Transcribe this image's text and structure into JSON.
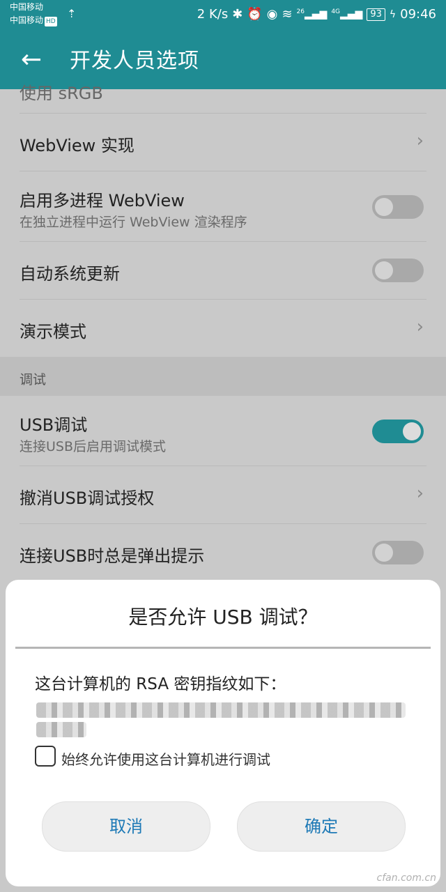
{
  "status_bar": {
    "carrier1": "中国移动",
    "carrier2": "中国移动",
    "hd_badge": "HD",
    "speed": "2 K/s",
    "signal1_label": "26",
    "signal2_label": "4G",
    "battery": "93",
    "time": "09:46",
    "icons": [
      "usb-icon",
      "bluetooth-icon",
      "alarm-icon",
      "eye-comfort-icon",
      "wifi-icon",
      "signal-icon",
      "charging-icon"
    ]
  },
  "app_bar": {
    "title": "开发人员选项"
  },
  "settings": {
    "partial_top": "使用 sRGB",
    "webview_impl": "WebView 实现",
    "multiprocess_title": "启用多进程 WebView",
    "multiprocess_sub": "在独立进程中运行 WebView 渲染程序",
    "auto_update": "自动系统更新",
    "demo_mode": "演示模式",
    "section_debug": "调试",
    "usb_debug_title": "USB调试",
    "usb_debug_sub": "连接USB后启用调试模式",
    "revoke_usb": "撤消USB调试授权",
    "usb_popup": "连接USB时总是弹出提示"
  },
  "toggles": {
    "multiprocess": false,
    "auto_update": false,
    "usb_debug": true,
    "usb_popup": false
  },
  "dialog": {
    "title": "是否允许 USB 调试？",
    "message": "这台计算机的 RSA 密钥指纹如下：",
    "checkbox_label": "始终允许使用这台计算机进行调试",
    "checkbox_checked": false,
    "cancel": "取消",
    "ok": "确定"
  },
  "watermark": "cfan.com.cn",
  "colors": {
    "accent": "#1f8c93",
    "button_text": "#1d79b6"
  }
}
